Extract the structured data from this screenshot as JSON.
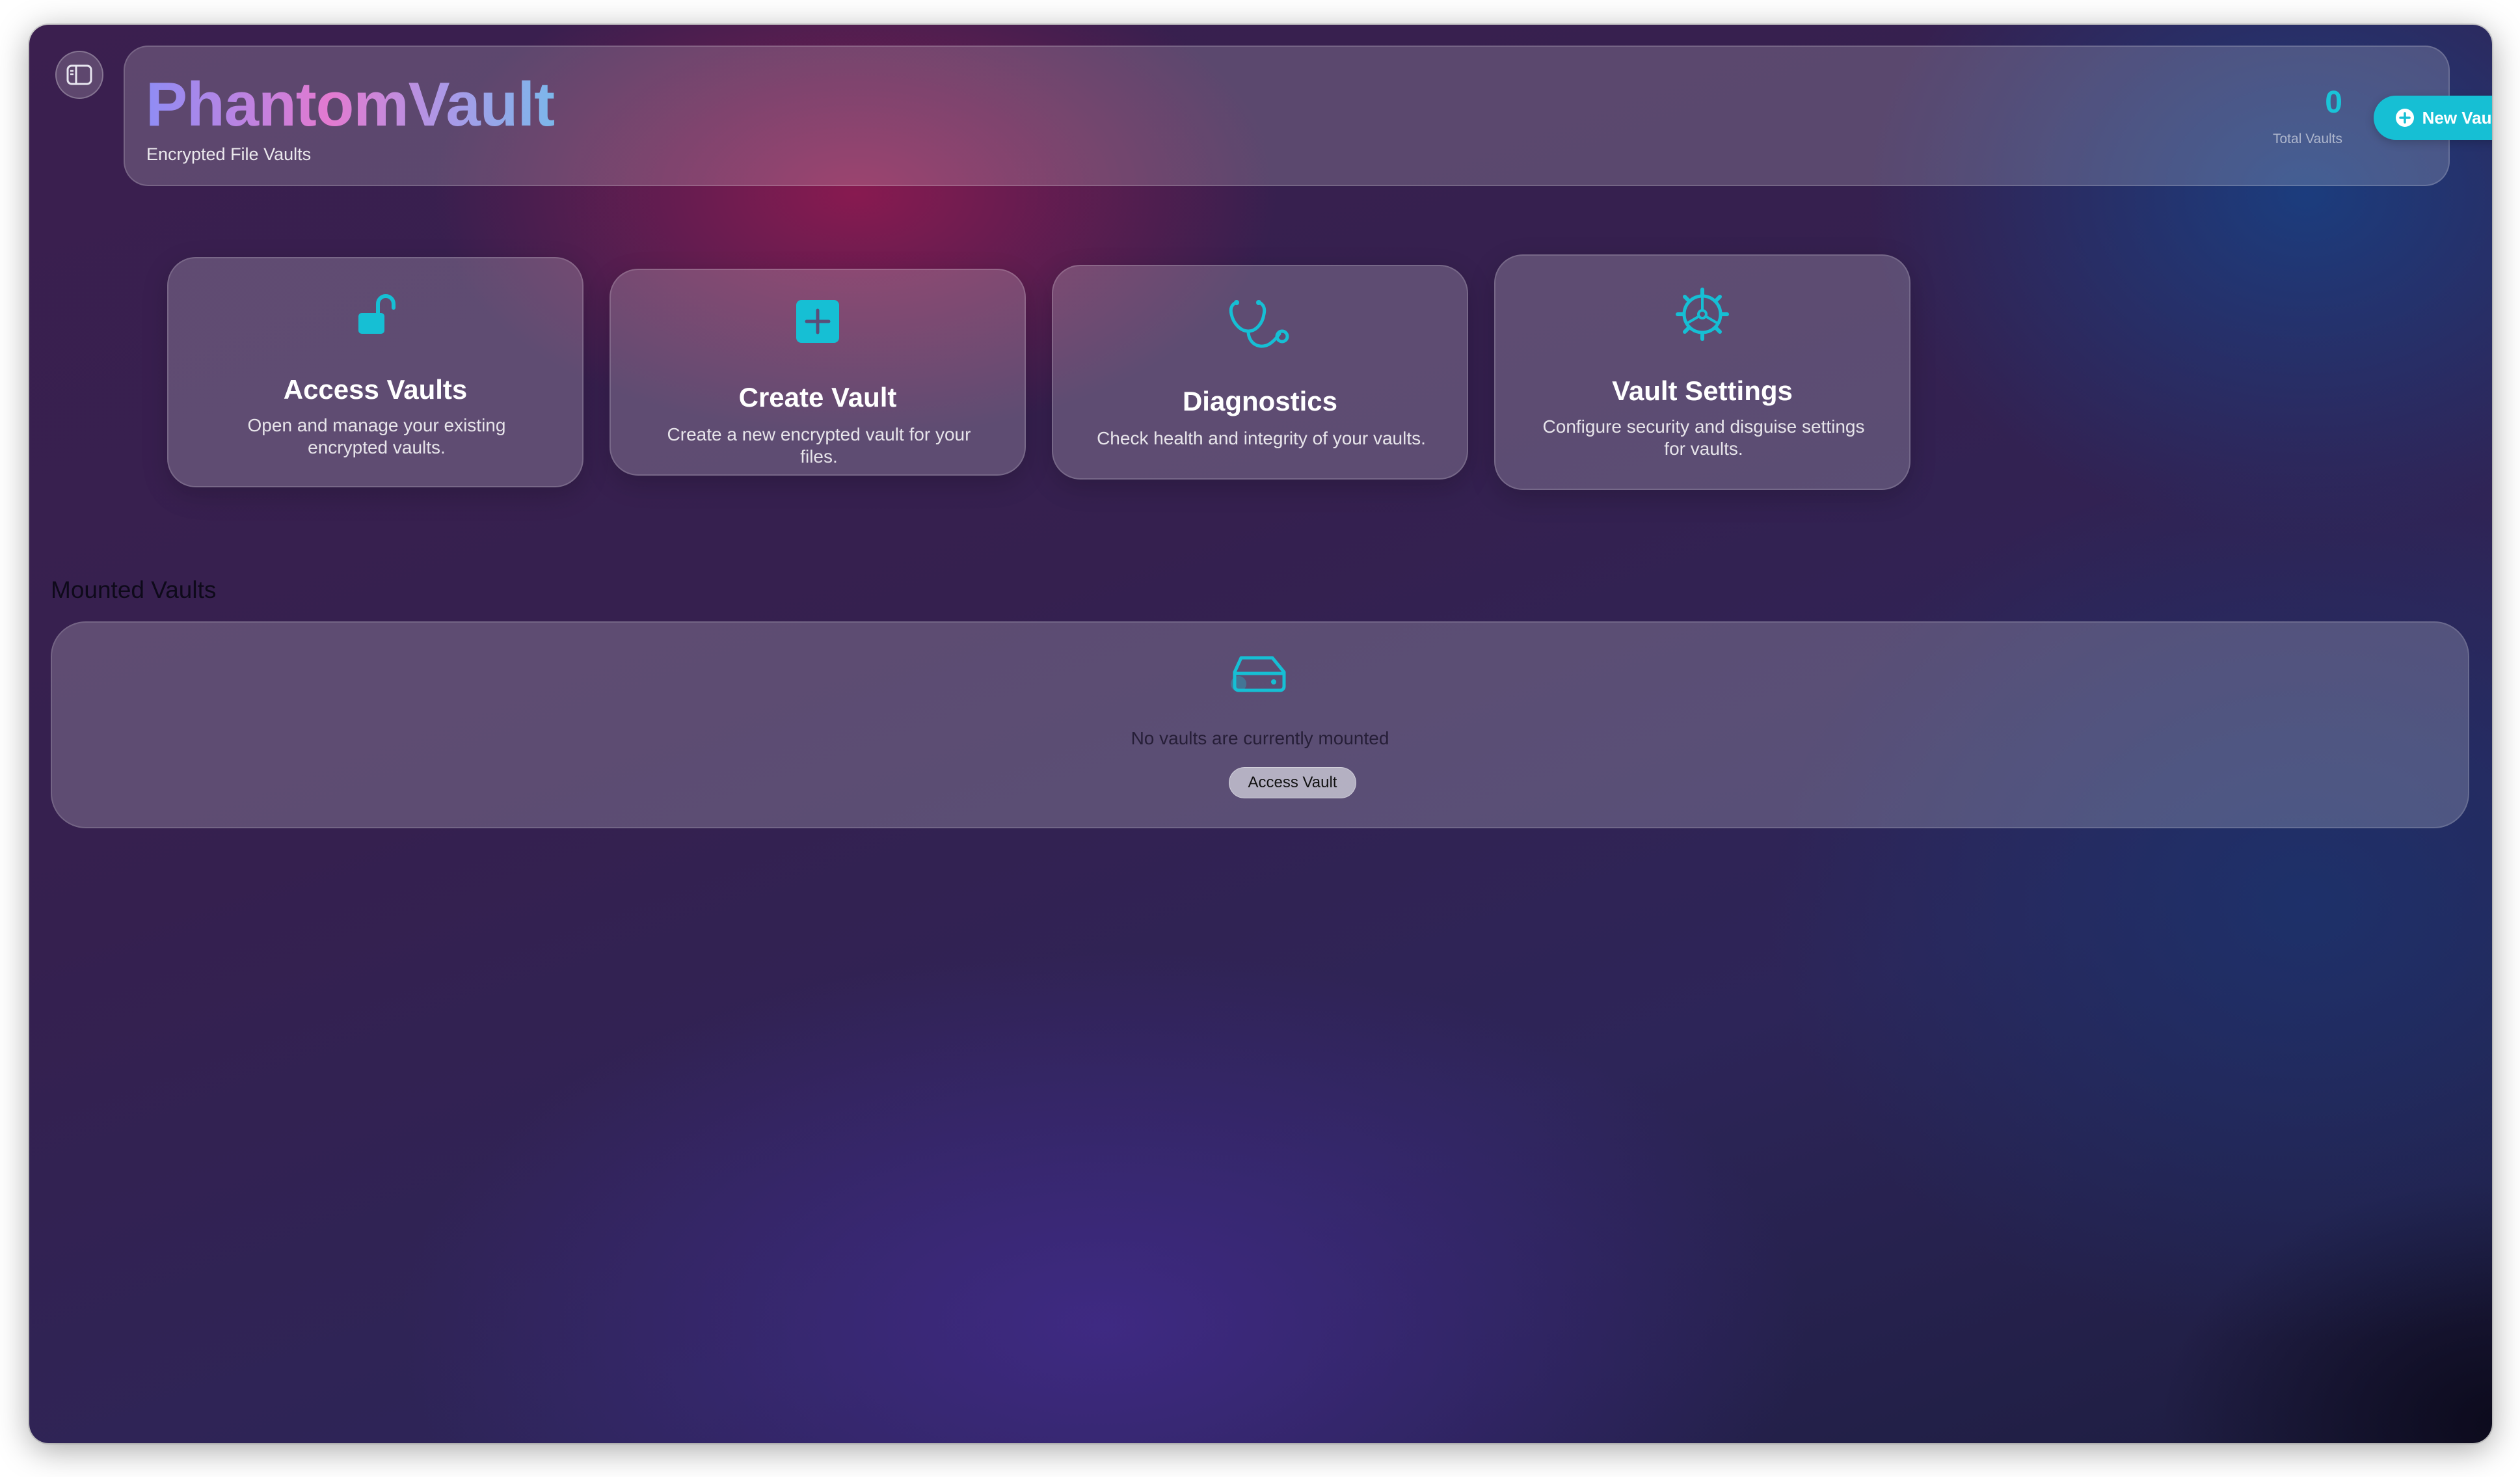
{
  "app": {
    "title": "PhantomVault",
    "subtitle": "Encrypted File Vaults"
  },
  "stats": {
    "total_vaults_value": "0",
    "total_vaults_label": "Total Vaults"
  },
  "header": {
    "new_vault_label": "New Vault"
  },
  "cards": [
    {
      "title": "Access Vaults",
      "description": "Open and manage your existing encrypted vaults.",
      "icon": "unlock-icon"
    },
    {
      "title": "Create Vault",
      "description": "Create a new encrypted vault for your files.",
      "icon": "plus-square-icon"
    },
    {
      "title": "Diagnostics",
      "description": "Check health and integrity of your vaults.",
      "icon": "stethoscope-icon"
    },
    {
      "title": "Vault Settings",
      "description": "Configure security and disguise settings for vaults.",
      "icon": "gear-icon"
    }
  ],
  "mounted": {
    "section_title": "Mounted Vaults",
    "empty_message": "No vaults are currently mounted",
    "access_button_label": "Access Vault",
    "icon": "drive-icon"
  },
  "colors": {
    "accent": "#16bfd4"
  }
}
